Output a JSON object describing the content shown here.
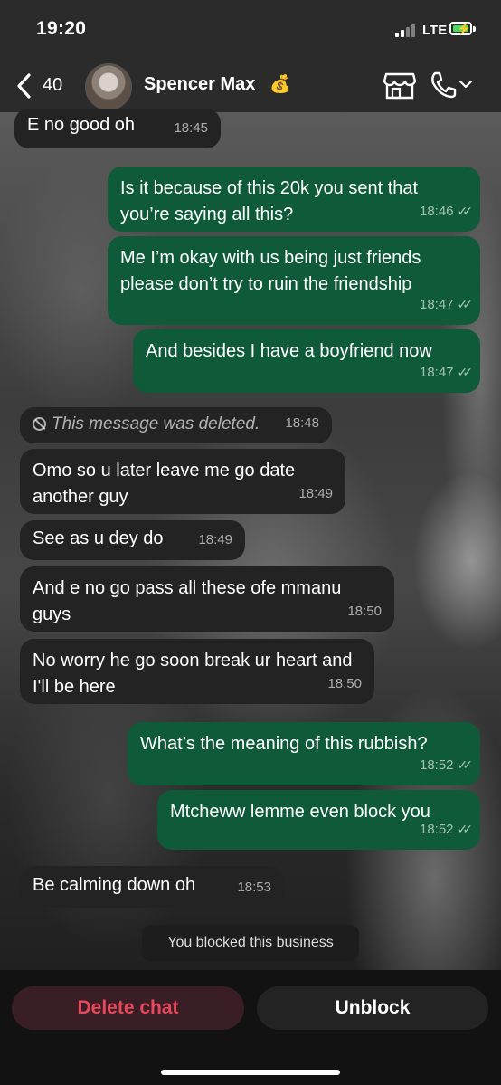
{
  "status": {
    "time": "19:20",
    "network": "LTE"
  },
  "header": {
    "back_count": "40",
    "contact_name": "Spencer Max",
    "name_emoji": "💰"
  },
  "messages": [
    {
      "dir": "in",
      "text": "E no good oh",
      "time": "18:45"
    },
    {
      "dir": "out",
      "text": "Is it because of this 20k you sent that you’re saying all this?",
      "time": "18:46"
    },
    {
      "dir": "out",
      "text": "Me I’m okay with us being just friends please don’t try to ruin the friendship",
      "time": "18:47"
    },
    {
      "dir": "out",
      "text": "And besides I have a boyfriend now",
      "time": "18:47"
    },
    {
      "dir": "in",
      "text": "This message was deleted.",
      "time": "18:48",
      "deleted": true
    },
    {
      "dir": "in",
      "text": "Omo so u later leave me go date another guy",
      "time": "18:49"
    },
    {
      "dir": "in",
      "text": "See as u dey do",
      "time": "18:49"
    },
    {
      "dir": "in",
      "text": "And e no go pass all these ofe mmanu guys",
      "time": "18:50"
    },
    {
      "dir": "in",
      "text": "No worry he go soon break ur heart and I'll be here",
      "time": "18:50"
    },
    {
      "dir": "out",
      "text": "What’s the meaning of this rubbish?",
      "time": "18:52"
    },
    {
      "dir": "out",
      "text": "Mtcheww lemme even block you",
      "time": "18:52"
    },
    {
      "dir": "in",
      "text": "Be calming down oh",
      "time": "18:53"
    }
  ],
  "system_note": "You blocked this business",
  "actions": {
    "delete_label": "Delete chat",
    "unblock_label": "Unblock"
  },
  "colors": {
    "incoming": "#232323",
    "outgoing": "#0e5a39",
    "danger": "#e8485c"
  }
}
